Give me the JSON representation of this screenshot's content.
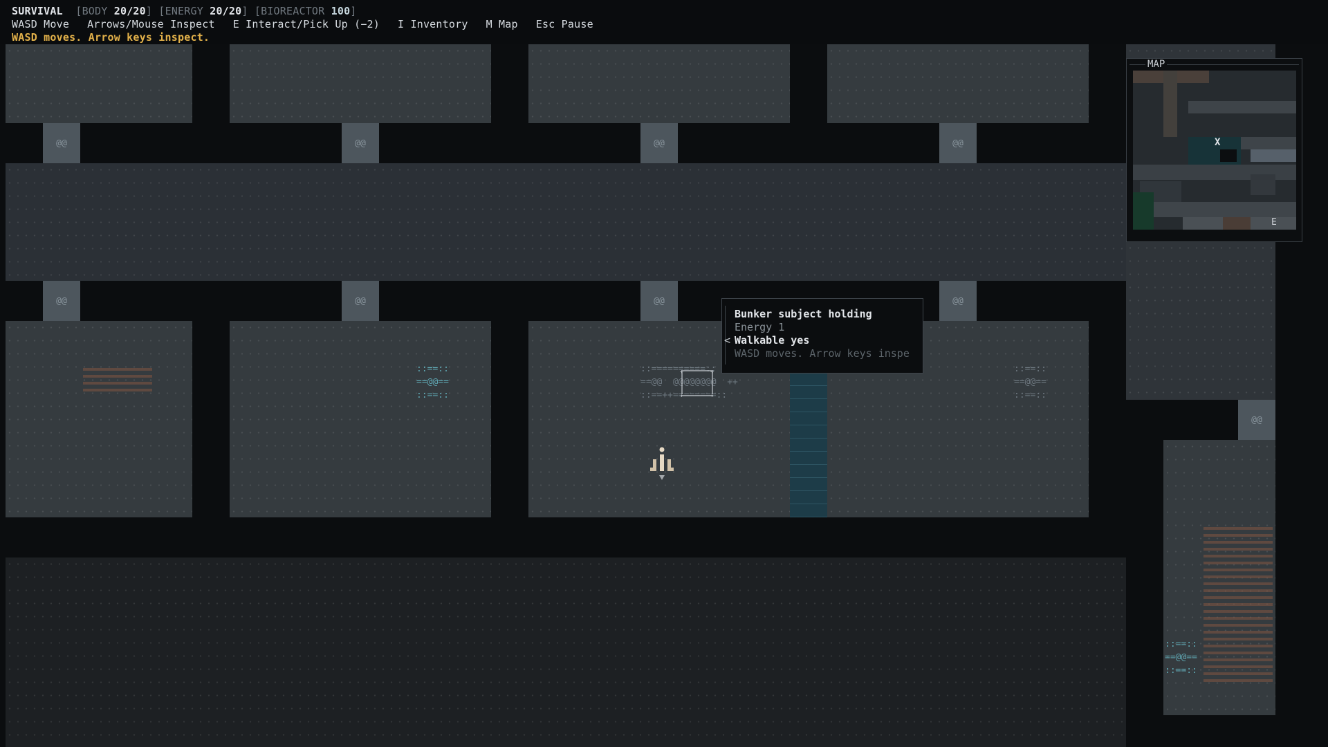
{
  "hud": {
    "mode": "SURVIVAL",
    "stats": [
      {
        "label": "BODY",
        "value": "20/20"
      },
      {
        "label": "ENERGY",
        "value": "20/20"
      },
      {
        "label": "BIOREACTOR",
        "value": "100"
      }
    ],
    "controls": [
      "WASD Move",
      "Arrows/Mouse Inspect",
      "E Interact/Pick Up (−2)",
      "I Inventory",
      "M Map",
      "Esc Pause"
    ],
    "message": "WASD moves. Arrow keys inspect."
  },
  "tooltip": {
    "title": "Bunker subject holding",
    "energy": "Energy 1",
    "walkable": "Walkable yes",
    "hint": "WASD moves. Arrow keys inspe",
    "caret": "<"
  },
  "minimap": {
    "title": "MAP",
    "marker": "X",
    "exit": "E"
  },
  "tiles": {
    "door": "@@",
    "console": "==@@=="
  },
  "colors": {
    "room_floor": "#353b3f",
    "corridor_floor": "#2b3036",
    "background": "#0b0d0f",
    "message": "#e2b14a",
    "water": "#1d3c48",
    "teal_fixture": "#5fa7b3"
  },
  "icons": {
    "player": "player-figure-icon"
  }
}
